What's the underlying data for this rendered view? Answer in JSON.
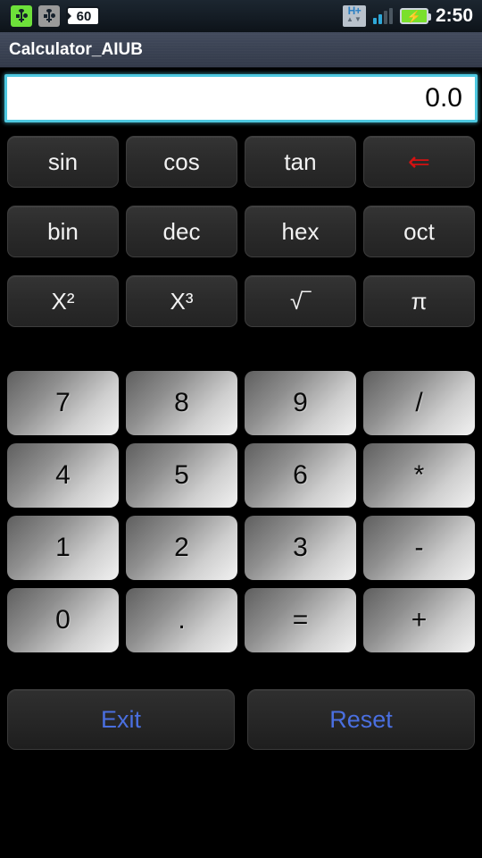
{
  "status_bar": {
    "usb_connected_icon": "usb-icon",
    "usb_secondary_icon": "usb-icon",
    "notification_count": "60",
    "network_type": "H+",
    "network_arrows": "▲▼",
    "signal_bars_total": 4,
    "signal_bars_active": 2,
    "battery_icon": "battery-charging-icon",
    "battery_bolt": "⚡",
    "time": "2:50"
  },
  "title_bar": {
    "title": "Calculator_AIUB"
  },
  "display": {
    "value": "0.0",
    "placeholder": "0.0"
  },
  "function_rows": [
    [
      {
        "label": "sin",
        "name": "sin-button",
        "style": "fn"
      },
      {
        "label": "cos",
        "name": "cos-button",
        "style": "fn"
      },
      {
        "label": "tan",
        "name": "tan-button",
        "style": "fn"
      },
      {
        "label": "⇐",
        "name": "backspace-button",
        "style": "back"
      }
    ],
    [
      {
        "label": "bin",
        "name": "binary-button",
        "style": "fn"
      },
      {
        "label": "dec",
        "name": "decimal-button",
        "style": "fn"
      },
      {
        "label": "hex",
        "name": "hexadecimal-button",
        "style": "fn"
      },
      {
        "label": "oct",
        "name": "octal-button",
        "style": "fn"
      }
    ],
    [
      {
        "label": "X²",
        "name": "square-button",
        "style": "fn"
      },
      {
        "label": "X³",
        "name": "cube-button",
        "style": "fn"
      },
      {
        "label": "√‾",
        "name": "square-root-button",
        "style": "fn"
      },
      {
        "label": "π",
        "name": "pi-button",
        "style": "fn"
      }
    ]
  ],
  "keypad_rows": [
    [
      {
        "label": "7",
        "name": "digit-7-button"
      },
      {
        "label": "8",
        "name": "digit-8-button"
      },
      {
        "label": "9",
        "name": "digit-9-button"
      },
      {
        "label": "/",
        "name": "divide-button"
      }
    ],
    [
      {
        "label": "4",
        "name": "digit-4-button"
      },
      {
        "label": "5",
        "name": "digit-5-button"
      },
      {
        "label": "6",
        "name": "digit-6-button"
      },
      {
        "label": "*",
        "name": "multiply-button"
      }
    ],
    [
      {
        "label": "1",
        "name": "digit-1-button"
      },
      {
        "label": "2",
        "name": "digit-2-button"
      },
      {
        "label": "3",
        "name": "digit-3-button"
      },
      {
        "label": "-",
        "name": "subtract-button"
      }
    ],
    [
      {
        "label": "0",
        "name": "digit-0-button"
      },
      {
        "label": ".",
        "name": "decimal-point-button"
      },
      {
        "label": "=",
        "name": "equals-button"
      },
      {
        "label": "+",
        "name": "add-button"
      }
    ]
  ],
  "actions": {
    "exit_label": "Exit",
    "reset_label": "Reset"
  },
  "colors": {
    "accent_blue": "#4a6fe0",
    "display_border": "#4ec8e0",
    "backspace_red": "#d41212",
    "title_bar": "#3a4253",
    "background": "#000000"
  }
}
